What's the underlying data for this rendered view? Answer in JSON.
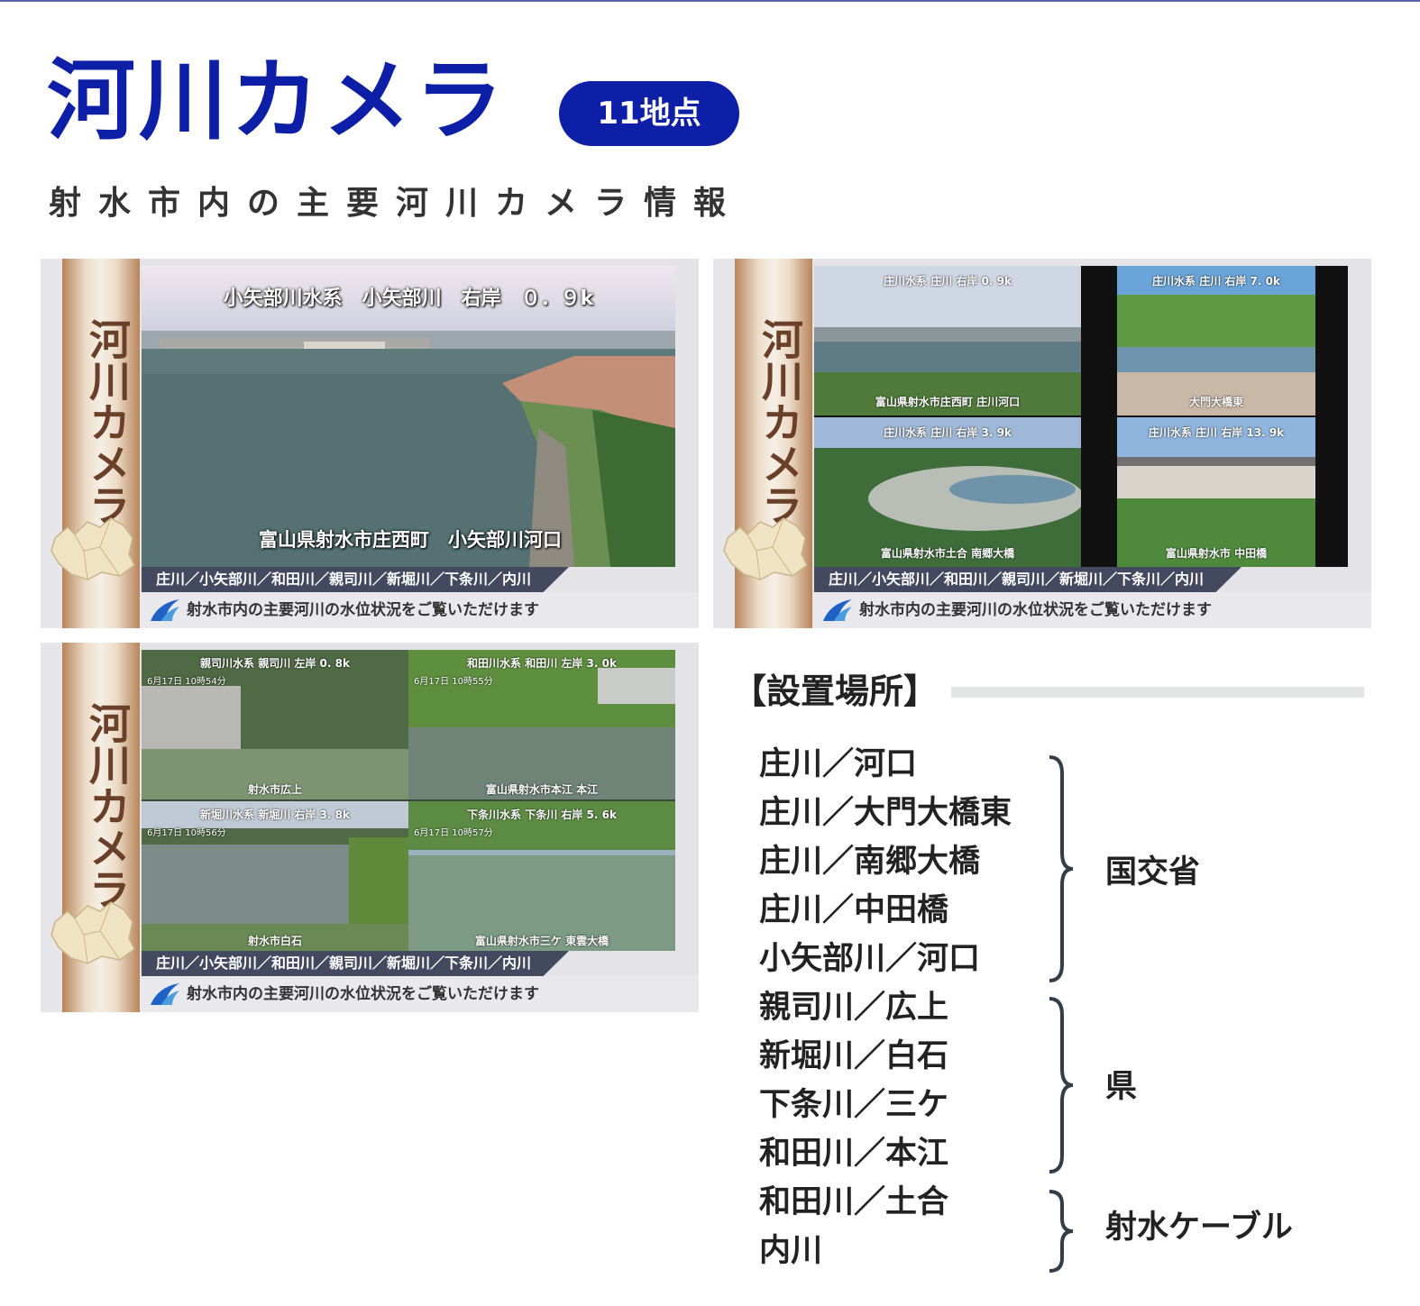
{
  "header": {
    "title": "河川カメラ",
    "badge": "11地点",
    "subtitle": "射水市内の主要河川カメラ情報"
  },
  "colors": {
    "accent": "#0d1fa6",
    "ticker": "#434a60",
    "band": "#b8845a"
  },
  "panels": {
    "side_title": "河川カメラ",
    "ticker": "庄川／小矢部川／和田川／親司川／新堀川／下条川／内川",
    "footer": "射水市内の主要河川の水位状況をご覧いただけます",
    "panel1": {
      "caption_top": "小矢部川水系　小矢部川　右岸　０．９k",
      "caption_bottom": "富山県射水市庄西町　小矢部川河口"
    },
    "panel2": {
      "q1_top": "庄川水系 庄川 右岸 0. 9k",
      "q1_bottom": "富山県射水市庄西町 庄川河口",
      "q2_top": "庄川水系 庄川 右岸 7. 0k",
      "q2_bottom": "大門大橋東",
      "q3_top": "庄川水系 庄川 右岸 3. 9k",
      "q3_bottom": "富山県射水市土合 南郷大橋",
      "q4_top": "庄川水系 庄川 右岸 13. 9k",
      "q4_bottom": "富山県射水市 中田橋"
    },
    "panel3": {
      "q1_top": "親司川水系 親司川 左岸 0. 8k",
      "q1_time": "6月17日 10時54分",
      "q1_bottom": "射水市広上",
      "q2_top": "和田川水系 和田川 左岸 3. 0k",
      "q2_time": "6月17日 10時55分",
      "q2_bottom": "富山県射水市本江 本江",
      "q3_top": "新堀川水系 新堀川 右岸 3. 8k",
      "q3_time": "6月17日 10時56分",
      "q3_bottom": "射水市白石",
      "q4_top": "下条川水系 下条川 右岸 5. 6k",
      "q4_time": "6月17日 10時57分",
      "q4_bottom": "富山県射水市三ケ 東雲大橋"
    }
  },
  "locations": {
    "header": "【設置場所】",
    "items": [
      "庄川／河口",
      "庄川／大門大橋東",
      "庄川／南郷大橋",
      "庄川／中田橋",
      "小矢部川／河口",
      "親司川／広上",
      "新堀川／白石",
      "下条川／三ケ",
      "和田川／本江",
      "和田川／土合",
      "内川"
    ],
    "groups": [
      "国交省",
      "県",
      "射水ケーブル"
    ]
  }
}
